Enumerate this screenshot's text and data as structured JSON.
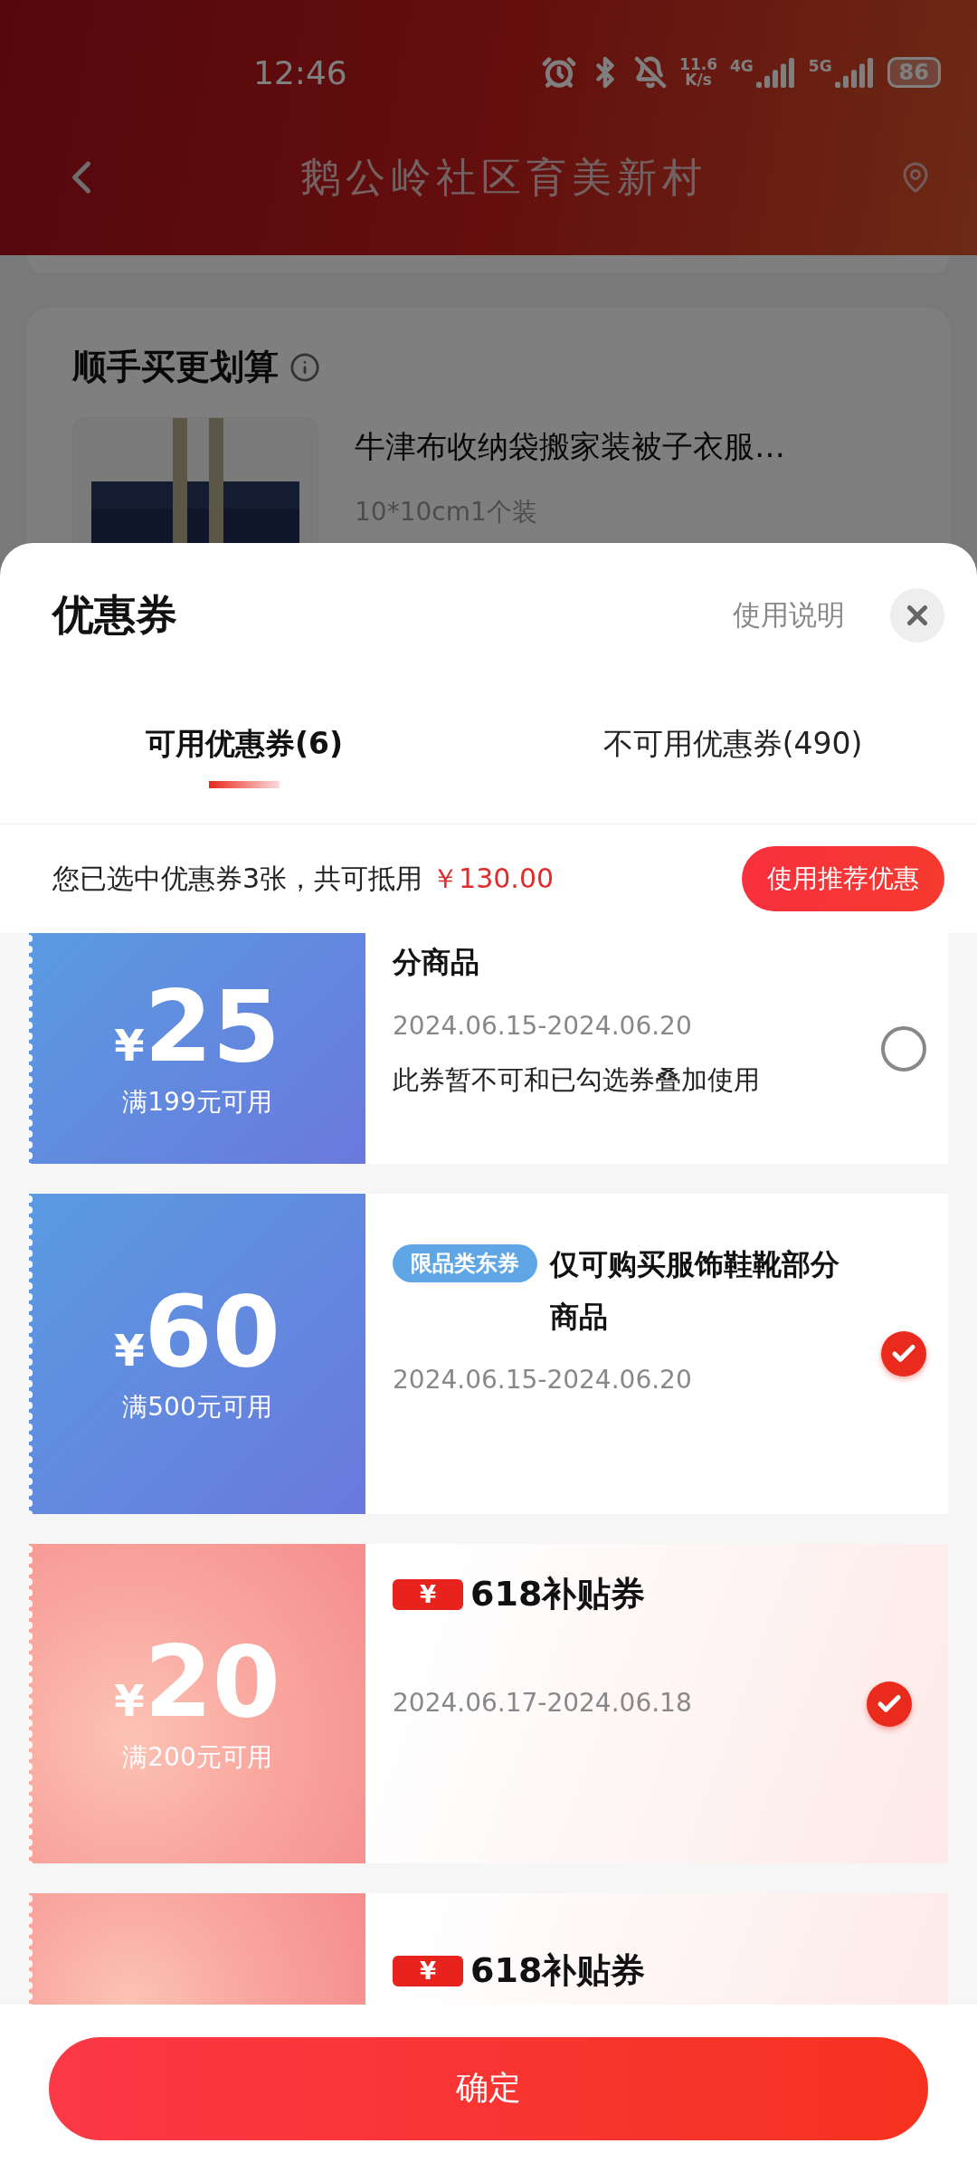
{
  "status_bar": {
    "time": "12:46",
    "net_speed": "11.6",
    "net_speed_unit": "K/s",
    "networks": [
      "4G",
      "5G"
    ],
    "battery": "86"
  },
  "header": {
    "title": "鹅公岭社区育美新村"
  },
  "background_card": {
    "title": "顺手买更划算",
    "product": {
      "name": "牛津布收纳袋搬家装被子衣服…",
      "spec": "10*10cm1个装"
    }
  },
  "sheet": {
    "title": "优惠券",
    "help_link": "使用说明",
    "tabs": [
      {
        "label": "可用优惠券(6)",
        "selected": true
      },
      {
        "label": "不可用优惠券(490)",
        "selected": false
      }
    ],
    "summary": {
      "text": "您已选中优惠券3张，共可抵用",
      "amount": "￥130.00",
      "button": "使用推荐优惠"
    },
    "coupons": [
      {
        "kind": "blue",
        "currency": "¥",
        "amount": "25",
        "condition": "满199元可用",
        "title": "分商品",
        "date": "2024.06.15-2024.06.20",
        "note": "此券暂不可和已勾选券叠加使用",
        "selected": false
      },
      {
        "kind": "blue",
        "currency": "¥",
        "amount": "60",
        "condition": "满500元可用",
        "tag": {
          "kind": "pill",
          "text": "限品类东券"
        },
        "title": "仅可购买服饰鞋靴部分商品",
        "date": "2024.06.15-2024.06.20",
        "selected": true
      },
      {
        "kind": "subsidy",
        "currency": "¥",
        "amount": "20",
        "condition": "满200元可用",
        "tag": {
          "kind": "ticket",
          "symbol": "¥",
          "text": "618补贴券"
        },
        "date": "2024.06.17-2024.06.18",
        "selected": true
      },
      {
        "kind": "subsidy",
        "tag": {
          "kind": "ticket",
          "symbol": "¥",
          "text": "618补贴券"
        }
      }
    ],
    "confirm_button": "确定"
  }
}
